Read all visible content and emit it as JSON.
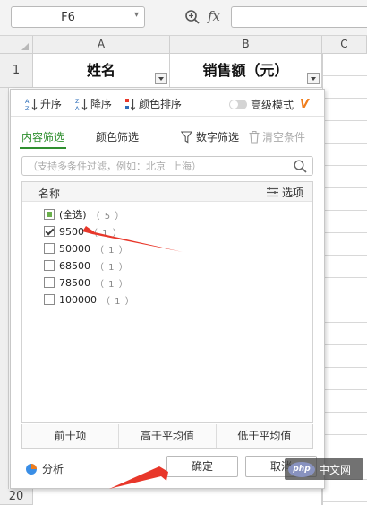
{
  "toolbar": {
    "name_box": "F6",
    "fx_label": "fx",
    "formula_value": ""
  },
  "sheet": {
    "column_headers": [
      "A",
      "B",
      "C"
    ],
    "row_headers": [
      "1",
      "20"
    ],
    "header_cells": [
      "姓名",
      "销售额（元）"
    ]
  },
  "filter_panel": {
    "sort": {
      "asc_label": "升序",
      "desc_label": "降序",
      "color_sort_label": "颜色排序",
      "advanced_label": "高级模式",
      "advanced_enabled": false,
      "advanced_badge": "V"
    },
    "tabs": {
      "content_filter": "内容筛选",
      "color_filter": "颜色筛选",
      "active": "内容筛选"
    },
    "number_filter_label": "数字筛选",
    "clear_label": "清空条件",
    "search": {
      "placeholder": "（支持多条件过滤，例如：北京  上海）",
      "value": ""
    },
    "list": {
      "name_header": "名称",
      "options_label": "选项",
      "items": [
        {
          "label": "(全选)",
          "count": "（ 5 ）",
          "state": "partial"
        },
        {
          "label": "9500",
          "count": "（ 1 ）",
          "state": "checked"
        },
        {
          "label": "50000",
          "count": "（ 1 ）",
          "state": "unchecked"
        },
        {
          "label": "68500",
          "count": "（ 1 ）",
          "state": "unchecked"
        },
        {
          "label": "78500",
          "count": "（ 1 ）",
          "state": "unchecked"
        },
        {
          "label": "100000",
          "count": "（ 1 ）",
          "state": "unchecked"
        }
      ]
    },
    "quick_filters": [
      "前十项",
      "高于平均值",
      "低于平均值"
    ],
    "analyze_label": "分析",
    "ok_label": "确定",
    "cancel_label": "取消"
  },
  "watermark": {
    "logo_text": "php",
    "text": "中文网"
  },
  "colors": {
    "active_tab": "#2f8f2f",
    "partial_check": "#6ab04c",
    "annotation_arrow": "#e8372a",
    "advanced_badge": "#f07d1c"
  }
}
